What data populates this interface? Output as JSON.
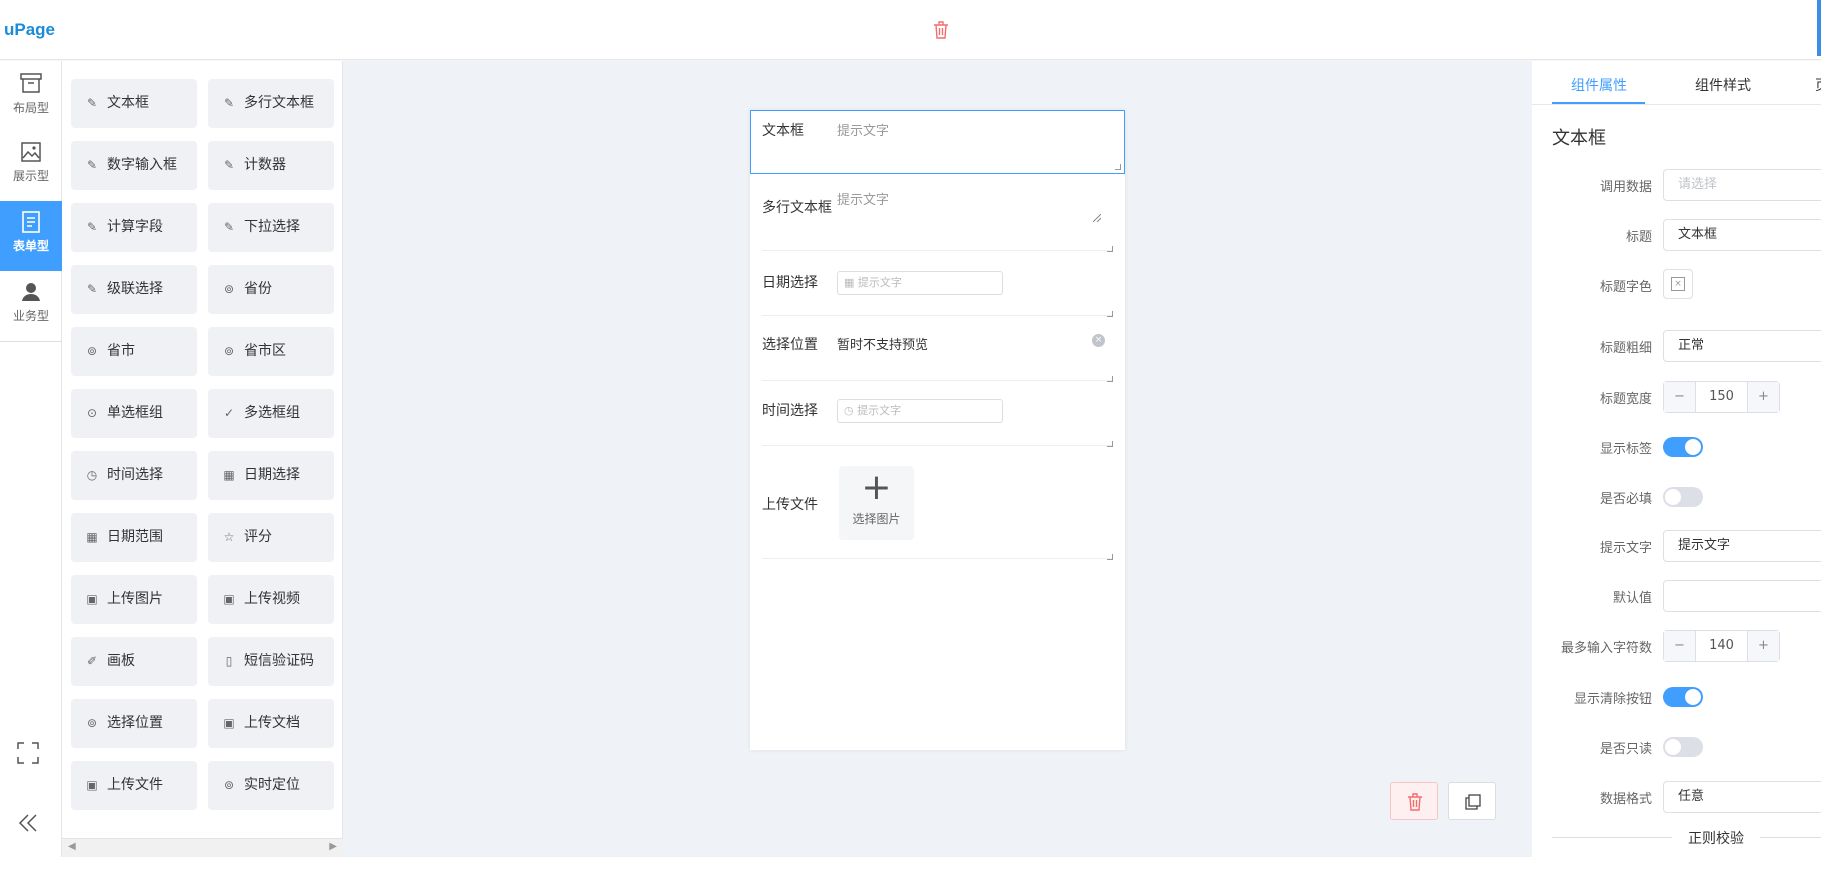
{
  "app": {
    "logo": "uPage"
  },
  "leftnav": {
    "items": [
      {
        "label": "布局型",
        "active": false
      },
      {
        "label": "展示型",
        "active": false
      },
      {
        "label": "表单型",
        "active": true
      },
      {
        "label": "业务型",
        "active": false
      }
    ]
  },
  "palette": {
    "items": [
      {
        "label": "文本框",
        "icon": "pencil-icon"
      },
      {
        "label": "多行文本框",
        "icon": "pencil-icon"
      },
      {
        "label": "数字输入框",
        "icon": "pencil-icon"
      },
      {
        "label": "计数器",
        "icon": "pencil-icon"
      },
      {
        "label": "计算字段",
        "icon": "pencil-icon"
      },
      {
        "label": "下拉选择",
        "icon": "pencil-icon"
      },
      {
        "label": "级联选择",
        "icon": "pencil-icon"
      },
      {
        "label": "省份",
        "icon": "location-icon"
      },
      {
        "label": "省市",
        "icon": "location-icon"
      },
      {
        "label": "省市区",
        "icon": "location-icon"
      },
      {
        "label": "单选框组",
        "icon": "radio-icon"
      },
      {
        "label": "多选框组",
        "icon": "check-circle-icon"
      },
      {
        "label": "时间选择",
        "icon": "clock-icon"
      },
      {
        "label": "日期选择",
        "icon": "calendar-icon"
      },
      {
        "label": "日期范围",
        "icon": "calendar-icon"
      },
      {
        "label": "评分",
        "icon": "star-icon"
      },
      {
        "label": "上传图片",
        "icon": "image-icon"
      },
      {
        "label": "上传视频",
        "icon": "image-icon"
      },
      {
        "label": "画板",
        "icon": "edit-box-icon"
      },
      {
        "label": "短信验证码",
        "icon": "phone-icon"
      },
      {
        "label": "选择位置",
        "icon": "map-pin-icon"
      },
      {
        "label": "上传文档",
        "icon": "image-icon"
      },
      {
        "label": "上传文件",
        "icon": "image-icon"
      },
      {
        "label": "实时定位",
        "icon": "map-pin-icon"
      }
    ]
  },
  "form": {
    "textbox": {
      "label": "文本框",
      "placeholder": "提示文字"
    },
    "textarea": {
      "label": "多行文本框",
      "placeholder": "提示文字"
    },
    "date": {
      "label": "日期选择",
      "placeholder": "提示文字"
    },
    "location": {
      "label": "选择位置",
      "value": "暂时不支持预览"
    },
    "time": {
      "label": "时间选择",
      "placeholder": "提示文字"
    },
    "upload": {
      "label": "上传文件",
      "button": "选择图片"
    }
  },
  "panel": {
    "tabs": [
      "组件属性",
      "组件样式",
      "页"
    ],
    "component_title": "文本框",
    "props": {
      "data_source": {
        "label": "调用数据",
        "placeholder": "请选择"
      },
      "title": {
        "label": "标题",
        "value": "文本框"
      },
      "title_color": {
        "label": "标题字色"
      },
      "title_weight": {
        "label": "标题粗细",
        "value": "正常"
      },
      "title_width": {
        "label": "标题宽度",
        "value": "150"
      },
      "show_label": {
        "label": "显示标签",
        "on": true
      },
      "required": {
        "label": "是否必填",
        "on": false
      },
      "placeholder": {
        "label": "提示文字",
        "value": "提示文字"
      },
      "default": {
        "label": "默认值",
        "value": ""
      },
      "max_len": {
        "label": "最多输入字符数",
        "value": "140"
      },
      "show_clear": {
        "label": "显示清除按钮",
        "on": true
      },
      "readonly": {
        "label": "是否只读",
        "on": false
      },
      "data_format": {
        "label": "数据格式",
        "value": "任意"
      }
    },
    "section": "正则校验"
  },
  "colors": {
    "accent": "#409eff",
    "danger": "#f56c6c",
    "canvas_bg": "#eff2f6"
  }
}
